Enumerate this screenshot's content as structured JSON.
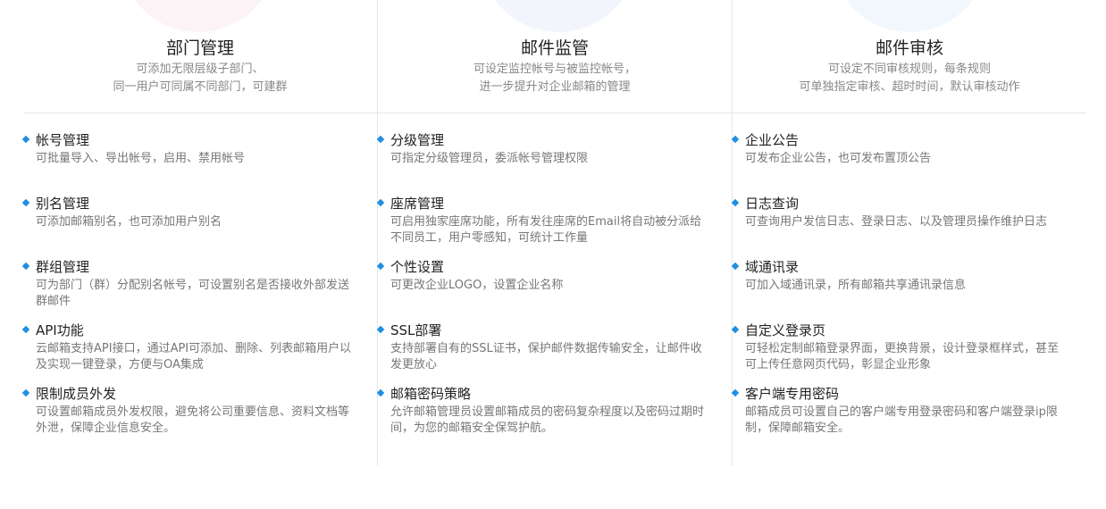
{
  "columns": [
    {
      "title": "部门管理",
      "sub1": "可添加无限层级子部门、",
      "sub2": "同一用户可同属不同部门，可建群",
      "items": [
        {
          "name": "帐号管理",
          "desc": "可批量导入、导出帐号，启用、禁用帐号"
        },
        {
          "name": "别名管理",
          "desc": "可添加邮箱别名，也可添加用户别名"
        },
        {
          "name": "群组管理",
          "desc": "可为部门（群）分配别名帐号，可设置别名是否接收外部发送群邮件"
        },
        {
          "name": "API功能",
          "desc": "云邮箱支持API接口，通过API可添加、删除、列表邮箱用户以及实现一键登录，方便与OA集成"
        },
        {
          "name": "限制成员外发",
          "desc": "可设置邮箱成员外发权限，避免将公司重要信息、资料文档等外泄，保障企业信息安全。"
        }
      ]
    },
    {
      "title": "邮件监管",
      "sub1": "可设定监控帐号与被监控帐号，",
      "sub2": "进一步提升对企业邮箱的管理",
      "items": [
        {
          "name": "分级管理",
          "desc": "可指定分级管理员，委派帐号管理权限"
        },
        {
          "name": "座席管理",
          "desc": "可启用独家座席功能，所有发往座席的Email将自动被分派给不同员工，用户零感知，可统计工作量"
        },
        {
          "name": "个性设置",
          "desc": "可更改企业LOGO，设置企业名称"
        },
        {
          "name": "SSL部署",
          "desc": "支持部署自有的SSL证书，保护邮件数据传输安全，让邮件收发更放心"
        },
        {
          "name": "邮箱密码策略",
          "desc": "允许邮箱管理员设置邮箱成员的密码复杂程度以及密码过期时间，为您的邮箱安全保驾护航。"
        }
      ]
    },
    {
      "title": "邮件审核",
      "sub1": "可设定不同审核规则，每条规则",
      "sub2": "可单独指定审核、超时时间，默认审核动作",
      "items": [
        {
          "name": "企业公告",
          "desc": "可发布企业公告，也可发布置顶公告"
        },
        {
          "name": "日志查询",
          "desc": "可查询用户发信日志、登录日志、以及管理员操作维护日志"
        },
        {
          "name": "域通讯录",
          "desc": "可加入域通讯录，所有邮箱共享通讯录信息"
        },
        {
          "name": "自定义登录页",
          "desc": "可轻松定制邮箱登录界面，更换背景，设计登录框样式，甚至可上传任意网页代码，彰显企业形象"
        },
        {
          "name": "客户端专用密码",
          "desc": "邮箱成员可设置自己的客户端专用登录密码和客户端登录ip限制，保障邮箱安全。"
        }
      ]
    }
  ]
}
